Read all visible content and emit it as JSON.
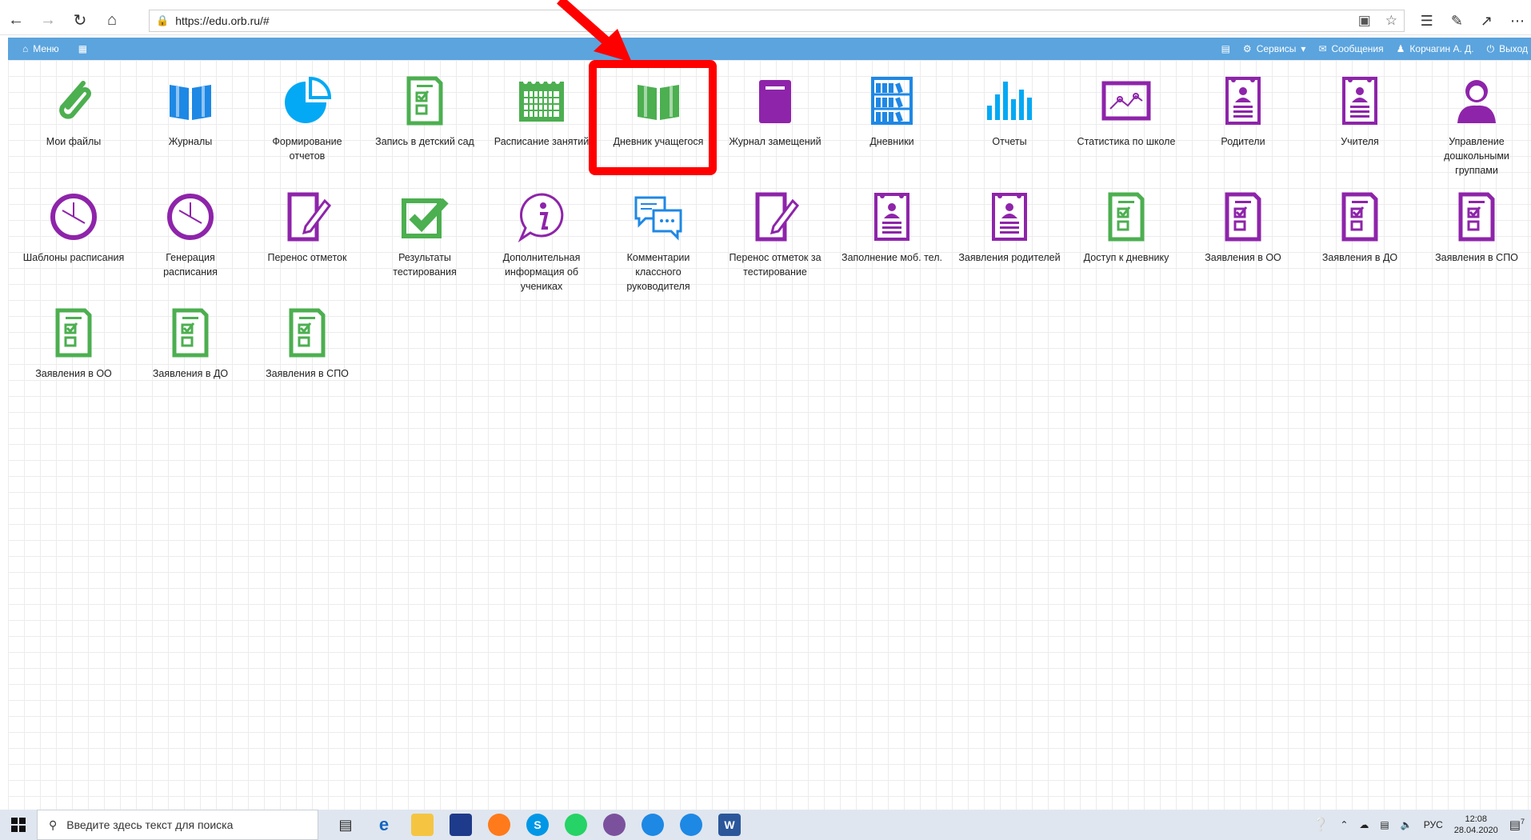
{
  "browser": {
    "url": "https://edu.orb.ru/#"
  },
  "nav": {
    "menu_label": "Меню",
    "services_label": "Сервисы",
    "messages_label": "Сообщения",
    "user_label": "Корчагин А. Д.",
    "exit_label": "Выход"
  },
  "tiles": [
    {
      "label": "Мои файлы",
      "icon": "paperclip-icon",
      "color": "#4caf50"
    },
    {
      "label": "Журналы",
      "icon": "open-book-icon",
      "color": "#1e88e5"
    },
    {
      "label": "Формирование отчетов",
      "icon": "pie-chart-icon",
      "color": "#03a9f4"
    },
    {
      "label": "Запись в детский сад",
      "icon": "checklist-doc-icon",
      "color": "#4caf50"
    },
    {
      "label": "Расписание занятий",
      "icon": "calendar-icon",
      "color": "#4caf50"
    },
    {
      "label": "Дневник учащегося",
      "icon": "open-book-icon",
      "color": "#4caf50"
    },
    {
      "label": "Журнал замещений",
      "icon": "closed-book-icon",
      "color": "#8e24aa"
    },
    {
      "label": "Дневники",
      "icon": "bookshelf-icon",
      "color": "#1e88e5"
    },
    {
      "label": "Отчеты",
      "icon": "bar-chart-icon",
      "color": "#03a9f4"
    },
    {
      "label": "Статистика по школе",
      "icon": "line-chart-icon",
      "color": "#8e24aa"
    },
    {
      "label": "Родители",
      "icon": "person-doc-icon",
      "color": "#8e24aa"
    },
    {
      "label": "Учителя",
      "icon": "person-doc-icon",
      "color": "#8e24aa"
    },
    {
      "label": "Управление дошкольными группами",
      "icon": "user-icon",
      "color": "#8e24aa"
    },
    {
      "label": "Шаблоны расписания",
      "icon": "clock-icon",
      "color": "#8e24aa"
    },
    {
      "label": "Генерация расписания",
      "icon": "clock-icon",
      "color": "#8e24aa"
    },
    {
      "label": "Перенос отметок",
      "icon": "edit-doc-icon",
      "color": "#8e24aa"
    },
    {
      "label": "Результаты тестирования",
      "icon": "checkmark-icon",
      "color": "#4caf50"
    },
    {
      "label": "Дополнительная информация об учениках",
      "icon": "info-bubble-icon",
      "color": "#8e24aa"
    },
    {
      "label": "Комментарии классного руководителя",
      "icon": "chat-bubbles-icon",
      "color": "#1e88e5"
    },
    {
      "label": "Перенос отметок за тестирование",
      "icon": "edit-doc-icon",
      "color": "#8e24aa"
    },
    {
      "label": "Заполнение моб. тел.",
      "icon": "person-doc-icon",
      "color": "#8e24aa"
    },
    {
      "label": "Заявления родителей",
      "icon": "person-doc-icon",
      "color": "#8e24aa"
    },
    {
      "label": "Доступ к дневнику",
      "icon": "checklist-doc-icon",
      "color": "#4caf50"
    },
    {
      "label": "Заявления в ОО",
      "icon": "checklist-doc-icon",
      "color": "#8e24aa"
    },
    {
      "label": "Заявления в ДО",
      "icon": "checklist-doc-icon",
      "color": "#8e24aa"
    },
    {
      "label": "Заявления в СПО",
      "icon": "checklist-doc-icon",
      "color": "#8e24aa"
    },
    {
      "label": "Заявления в ОО",
      "icon": "checklist-doc-icon",
      "color": "#4caf50"
    },
    {
      "label": "Заявления в ДО",
      "icon": "checklist-doc-icon",
      "color": "#4caf50"
    },
    {
      "label": "Заявления в СПО",
      "icon": "checklist-doc-icon",
      "color": "#4caf50"
    }
  ],
  "highlighted_tile": "Дневник учащегося",
  "taskbar": {
    "search_placeholder": "Введите здесь текст для поиска",
    "language": "РУС",
    "time": "12:08",
    "date": "28.04.2020",
    "notification_count": "7"
  }
}
